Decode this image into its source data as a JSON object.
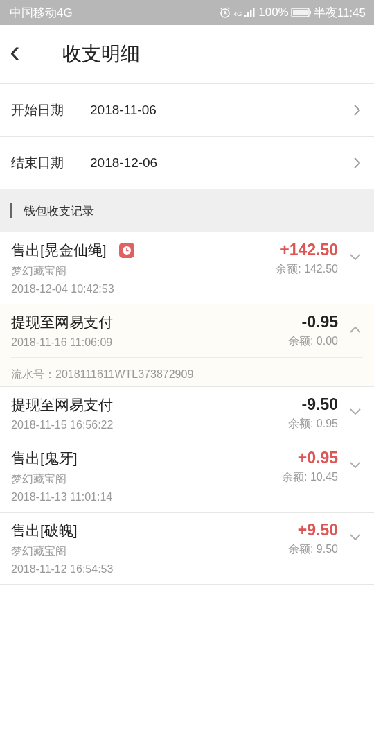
{
  "status_bar": {
    "carrier": "中国移动4G",
    "network": "4G",
    "battery": "100%",
    "time": "半夜11:45"
  },
  "header": {
    "back": "‹",
    "title": "收支明细"
  },
  "date_filters": [
    {
      "label": "开始日期",
      "value": "2018-11-06"
    },
    {
      "label": "结束日期",
      "value": "2018-12-06"
    }
  ],
  "section_title": "钱包收支记录",
  "records": [
    {
      "title": "售出[晃金仙绳]",
      "pending": true,
      "source": "梦幻藏宝阁",
      "time": "2018-12-04 10:42:53",
      "kind": "income",
      "amount": "+142.50",
      "balance": "余额: 142.50",
      "expanded": false
    },
    {
      "title": "提现至网易支付",
      "pending": false,
      "time": "2018-11-16 11:06:09",
      "kind": "expense",
      "amount": "-0.95",
      "balance": "余额: 0.00",
      "expanded": true,
      "serial": "流水号：2018111611WTL373872909"
    },
    {
      "title": "提现至网易支付",
      "pending": false,
      "time": "2018-11-15 16:56:22",
      "kind": "expense",
      "amount": "-9.50",
      "balance": "余额: 0.95",
      "expanded": false
    },
    {
      "title": "售出[鬼牙]",
      "pending": false,
      "source": "梦幻藏宝阁",
      "time": "2018-11-13 11:01:14",
      "kind": "income",
      "amount": "+0.95",
      "balance": "余额: 10.45",
      "expanded": false
    },
    {
      "title": "售出[破魄]",
      "pending": false,
      "source": "梦幻藏宝阁",
      "time": "2018-11-12 16:54:53",
      "kind": "income",
      "amount": "+9.50",
      "balance": "余额: 9.50",
      "expanded": false
    }
  ]
}
